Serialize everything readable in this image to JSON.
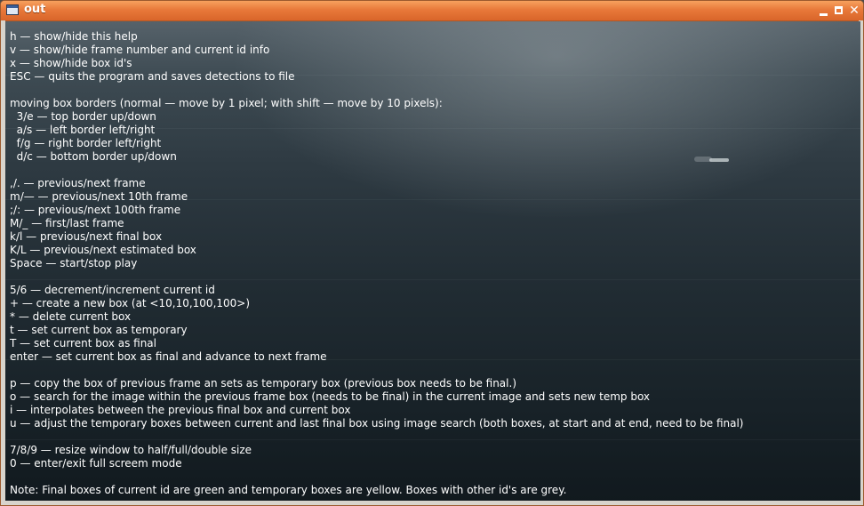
{
  "window": {
    "title": "out",
    "icons": {
      "app": "window-icon",
      "minimize": "minimize-icon",
      "maximize": "maximize-icon",
      "close": "close-icon"
    },
    "close_glyph": "✕"
  },
  "help": {
    "lines": [
      "h — show/hide this help",
      "v — show/hide frame number and current id info",
      "x — show/hide box id's",
      "ESC — quits the program and saves detections to file",
      "",
      "moving box borders (normal — move by 1 pixel; with shift — move by 10 pixels):",
      "  3/e — top border up/down",
      "  a/s — left border left/right",
      "  f/g — right border left/right",
      "  d/c — bottom border up/down",
      "",
      ",/. — previous/next frame",
      "m/— — previous/next 10th frame",
      ";/: — previous/next 100th frame",
      "M/_ — first/last frame",
      "k/l — previous/next final box",
      "K/L — previous/next estimated box",
      "Space — start/stop play",
      "",
      "5/6 — decrement/increment current id",
      "+ — create a new box (at <10,10,100,100>)",
      "* — delete current box",
      "t — set current box as temporary",
      "T — set current box as final",
      "enter — set current box as final and advance to next frame",
      "",
      "p — copy the box of previous frame an sets as temporary box (previous box needs to be final.)",
      "o — search for the image within the previous frame box (needs to be final) in the current image and sets new temp box",
      "i — interpolates between the previous final box and current box",
      "u — adjust the temporary boxes between current and last final box using image search (both boxes, at start and at end, need to be final)",
      "",
      "7/8/9 — resize window to half/full/double size",
      "0 — enter/exit full screem mode",
      "",
      "Note: Final boxes of current id are green and temporary boxes are yellow. Boxes with other id's are grey."
    ]
  },
  "colors": {
    "titlebar": "#e8793a",
    "text": "#ffffff",
    "sea_dark": "#11191e",
    "sea_light": "#56626a"
  }
}
